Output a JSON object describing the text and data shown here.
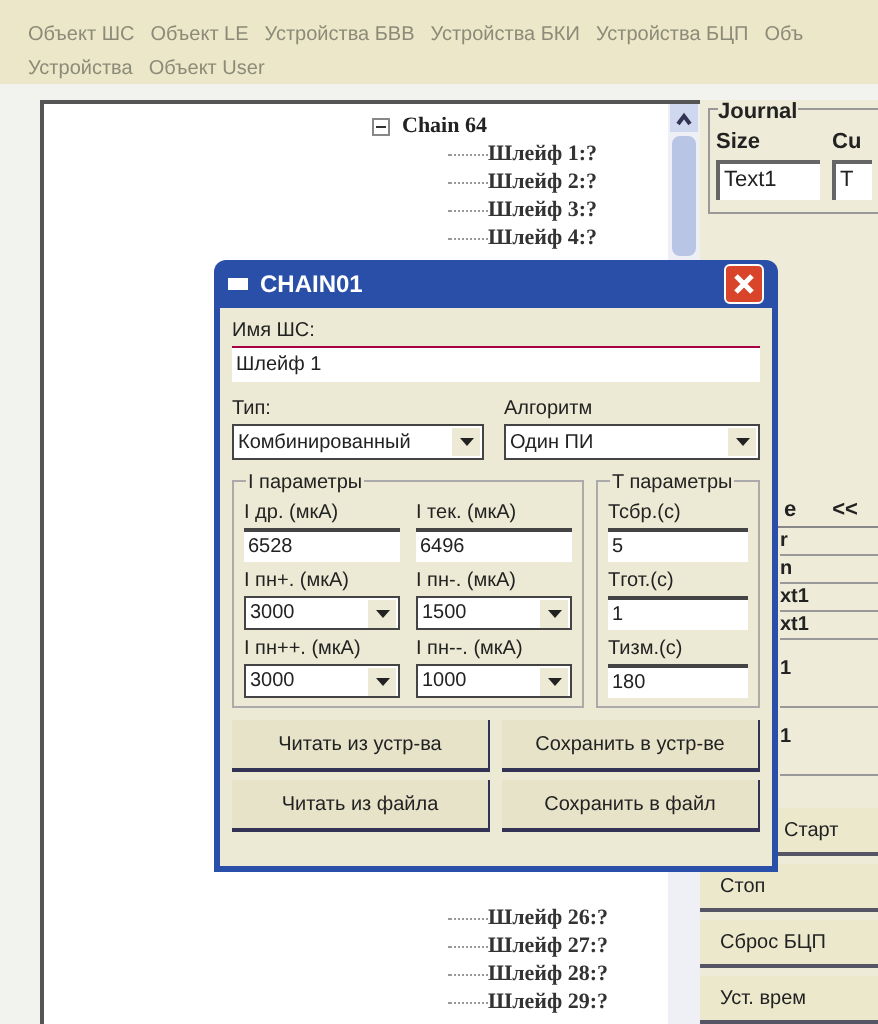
{
  "menu": [
    [
      "Объект ШС",
      "Объект LE",
      "Устройства БВВ",
      "Устройства БКИ",
      "Устройства БЦП",
      "Объ"
    ],
    [
      "Устройства",
      "Объект User"
    ]
  ],
  "tree": {
    "label": "Chain 64",
    "expanded": true,
    "children": [
      {
        "label": "Шлейф 1:?"
      },
      {
        "label": "Шлейф 2:?"
      },
      {
        "label": "Шлейф 3:?"
      },
      {
        "label": "Шлейф 4:?"
      }
    ],
    "more": [
      {
        "label": "Шлейф 26:?"
      },
      {
        "label": "Шлейф 27:?"
      },
      {
        "label": "Шлейф 28:?"
      },
      {
        "label": "Шлейф 29:?"
      }
    ]
  },
  "journal": {
    "title": "Journal",
    "columns": [
      "Size",
      "Cu"
    ],
    "values": [
      "Text1",
      "T"
    ]
  },
  "right_tabs": [
    "e",
    "<<"
  ],
  "right_fragments": [
    "r",
    "n",
    "xt1",
    "xt1",
    "1",
    "1"
  ],
  "right_buttons": [
    "Старт",
    "Стоп",
    "Сброс БЦП",
    "Уст. врем"
  ],
  "dialog": {
    "title": "CHAIN01",
    "name_label": "Имя ШС:",
    "name_value": "Шлейф 1",
    "type_label": "Тип:",
    "type_value": "Комбинированный",
    "algo_label": "Алгоритм",
    "algo_value": "Один ПИ",
    "i_group": "I параметры",
    "t_group": "T параметры",
    "i_fields": [
      {
        "label": "I др. (мкА)",
        "value": "6528",
        "kind": "text"
      },
      {
        "label": "I тек. (мкА)",
        "value": "6496",
        "kind": "text"
      },
      {
        "label": "I пн+. (мкА)",
        "value": "3000",
        "kind": "combo"
      },
      {
        "label": "I пн-. (мкА)",
        "value": "1500",
        "kind": "combo"
      },
      {
        "label": "I пн++. (мкА)",
        "value": "3000",
        "kind": "combo"
      },
      {
        "label": "I пн--. (мкА)",
        "value": "1000",
        "kind": "combo"
      }
    ],
    "t_fields": [
      {
        "label": "Тсбр.(с)",
        "value": "5"
      },
      {
        "label": "Тгот.(с)",
        "value": "1"
      },
      {
        "label": "Тизм.(с)",
        "value": "180"
      }
    ],
    "buttons": [
      "Читать из устр-ва",
      "Сохранить в устр-ве",
      "Читать из файла",
      "Сохранить в файл"
    ]
  }
}
